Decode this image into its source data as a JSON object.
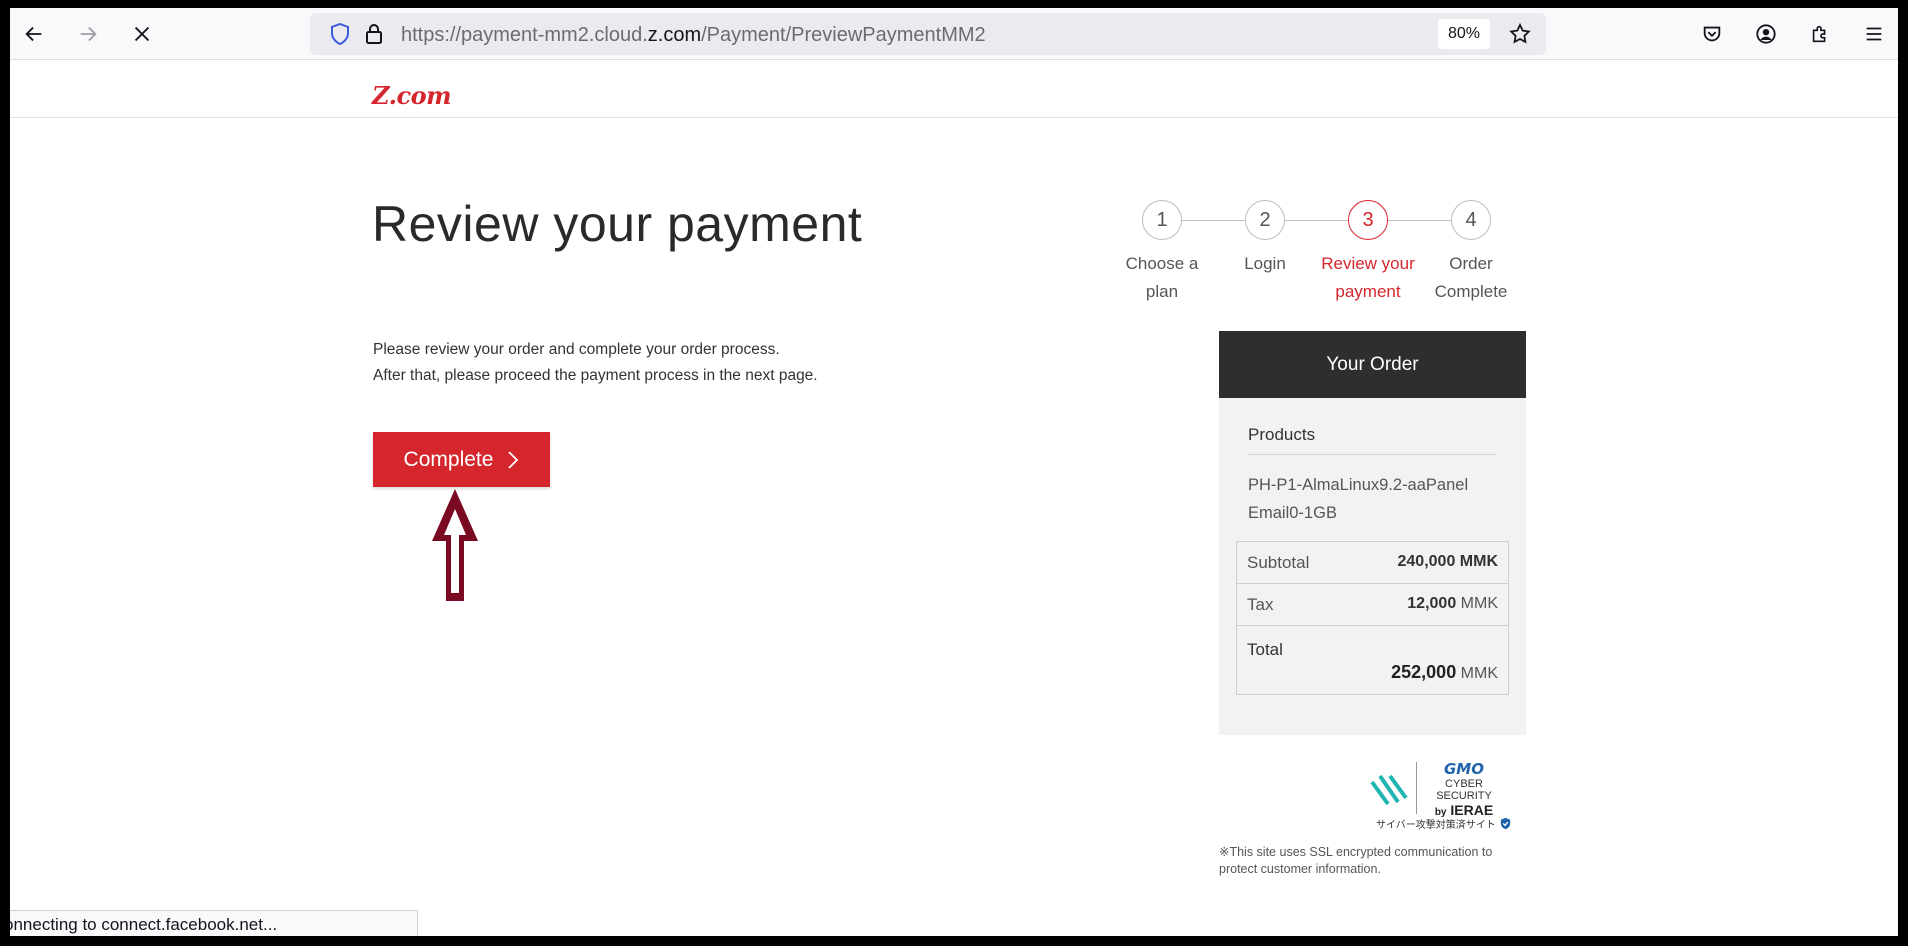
{
  "browser": {
    "url_prefix": "https://payment-mm2.cloud.",
    "url_host": "z.com",
    "url_path": "/Payment/PreviewPaymentMM2",
    "zoom": "80%",
    "status": "onnecting to connect.facebook.net..."
  },
  "site": {
    "logo": "Z.com"
  },
  "page": {
    "title": "Review your payment",
    "intro_line1": "Please review your order and complete your order process.",
    "intro_line2": "After that, please proceed the payment process in the next page.",
    "complete_label": "Complete"
  },
  "stepper": {
    "steps": [
      {
        "number": "1",
        "line1": "Choose a",
        "line2": "plan"
      },
      {
        "number": "2",
        "line1": "Login",
        "line2": ""
      },
      {
        "number": "3",
        "line1": "Review your",
        "line2": "payment"
      },
      {
        "number": "4",
        "line1": "Order",
        "line2": "Complete"
      }
    ],
    "active_step": 3
  },
  "order": {
    "heading": "Your Order",
    "products_title": "Products",
    "product_line1": "PH-P1-AlmaLinux9.2-aaPanel",
    "product_line2": "Email0-1GB",
    "subtotal_label": "Subtotal",
    "subtotal_value": "240,000 MMK",
    "tax_label": "Tax",
    "tax_value": "12,000",
    "tax_currency": "MMK",
    "total_label": "Total",
    "total_value": "252,000",
    "total_currency": "MMK"
  },
  "security": {
    "brand": "GMO",
    "line1": "CYBER SECURITY",
    "line2_by": "by",
    "line2": "IERAE",
    "jp_text": "サイバー攻撃対策済サイト",
    "ssl_note": "※This site uses SSL encrypted communication to protect customer information."
  },
  "colors": {
    "brand_red": "#d6262d",
    "order_header": "#2e2e2e",
    "annotation_arrow": "#7a0a22"
  }
}
